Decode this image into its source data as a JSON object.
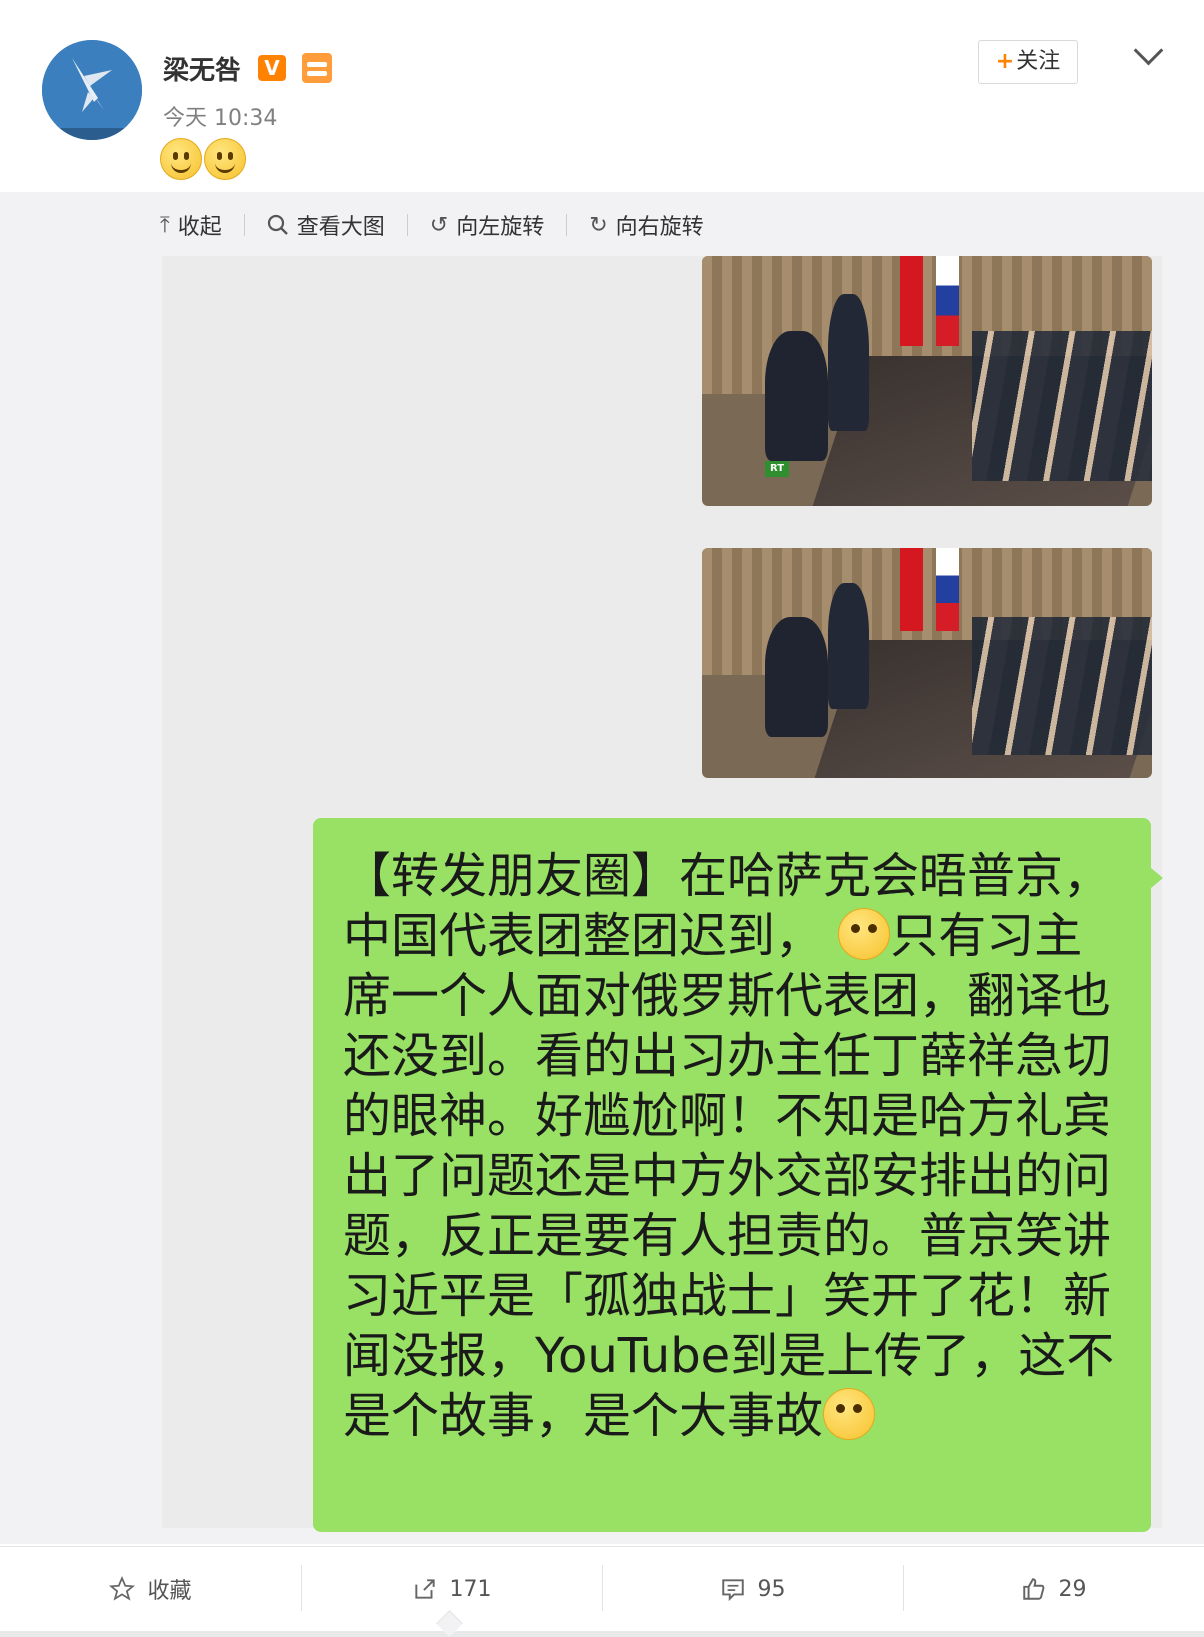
{
  "post": {
    "username": "梁无咎",
    "badge": "V",
    "timestamp": "今天 10:34",
    "follow_label": "关注",
    "follow_prefix": "+"
  },
  "toolbar": {
    "collapse_label": "收起",
    "view_large_label": "查看大图",
    "rotate_left_label": "向左旋转",
    "rotate_right_label": "向右旋转"
  },
  "screenshot": {
    "photo_watermark": "RT",
    "message_text_before_emoji1": "【转发朋友圈】在哈萨克会晤普京，中国代表团整团迟到，",
    "message_text_mid": "只有习主席一个人面对俄罗斯代表团，翻译也还没到。看的出习办主任丁薛祥急切的眼神。好尴尬啊！不知是哈方礼宾出了问题还是中方外交部安排出的问题，反正是要有人担责的。普京笑讲习近平是「孤独战士」笑开了花！新闻没报，YouTube到是上传了，这不是个故事，是个大事故"
  },
  "footer": {
    "favorite_label": "收藏",
    "repost_count": "171",
    "comment_count": "95",
    "like_count": "29"
  },
  "icons": [
    "plane-avatar-icon",
    "verified-v-icon",
    "member-badge-icon",
    "smile-emoji-icon",
    "chevron-down-icon",
    "collapse-icon",
    "search-icon",
    "rotate-left-icon",
    "rotate-right-icon",
    "star-icon",
    "repost-icon",
    "comment-icon",
    "thumbs-up-icon"
  ]
}
